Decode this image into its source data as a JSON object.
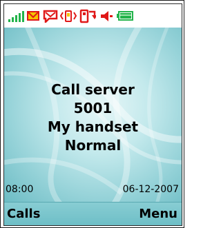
{
  "status_bar": {
    "icons": [
      "signal-strength-icon",
      "message-envelope-icon",
      "voicemail-icon",
      "vibrate-icon",
      "call-forward-icon",
      "ringer-volume-icon",
      "battery-icon"
    ]
  },
  "idle_screen": {
    "line1": "Call server",
    "line2": "5001",
    "line3": "My handset",
    "line4": "Normal",
    "time": "08:00",
    "date": "06-12-2007"
  },
  "softkeys": {
    "left_label": "Calls",
    "right_label": "Menu"
  },
  "colors": {
    "signal": "#22b34a",
    "icon_red": "#e01818",
    "icon_yellow": "#f5c400",
    "battery_fill": "#22b34a",
    "wallpaper": "#8ccfd6",
    "softkey_bar": "#7cc6cd"
  }
}
